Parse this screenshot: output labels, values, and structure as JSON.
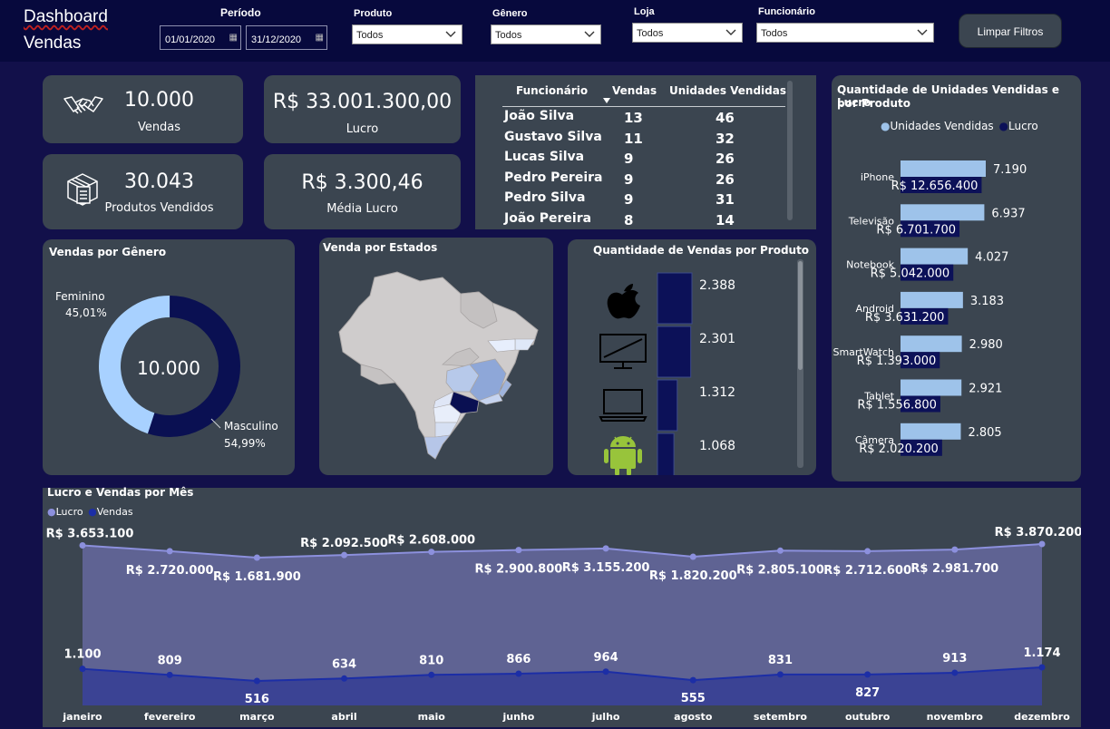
{
  "header": {
    "title_line1": "Dashboard",
    "title_line2": "Vendas",
    "periodo_label": "Período",
    "date_start": "01/01/2020",
    "date_end": "31/12/2020",
    "produto_label": "Produto",
    "produto_value": "Todos",
    "genero_label": "Gênero",
    "genero_value": "Todos",
    "loja_label": "Loja",
    "loja_value": "Todos",
    "funcionario_label": "Funcionário",
    "funcionario_value": "Todos",
    "clear_button": "Limpar Filtros"
  },
  "kpis": {
    "vendas_value": "10.000",
    "vendas_label": "Vendas",
    "lucro_value": "R$ 33.001.300,00",
    "lucro_label": "Lucro",
    "produtos_value": "30.043",
    "produtos_label": "Produtos Vendidos",
    "media_value": "R$ 3.300,46",
    "media_label": "Média Lucro"
  },
  "employees": {
    "headers": [
      "Funcionário",
      "Vendas",
      "Unidades Vendidas"
    ],
    "rows": [
      {
        "name": "João Silva",
        "vendas": "13",
        "unidades": "46"
      },
      {
        "name": "Gustavo Silva",
        "vendas": "11",
        "unidades": "32"
      },
      {
        "name": "Lucas Silva",
        "vendas": "9",
        "unidades": "26"
      },
      {
        "name": "Pedro Pereira",
        "vendas": "9",
        "unidades": "26"
      },
      {
        "name": "Pedro Silva",
        "vendas": "9",
        "unidades": "31"
      },
      {
        "name": "João Pereira",
        "vendas": "8",
        "unidades": "14"
      }
    ]
  },
  "genero": {
    "title": "Vendas por Gênero",
    "center": "10.000",
    "feminino_label": "Feminino",
    "feminino_pct": "45,01%",
    "masculino_label": "Masculino",
    "masculino_pct": "54,99%",
    "feminino_share": 0.4501,
    "masculino_share": 0.5499,
    "color_feminino": "#a8d1ff",
    "color_masculino": "#0a1052"
  },
  "estados": {
    "title": "Venda por Estados"
  },
  "produtos_vendas": {
    "title": "Quantidade de Vendas por Produto",
    "items": [
      {
        "icon": "apple-icon",
        "value": 2388,
        "label": "2.388"
      },
      {
        "icon": "television-icon",
        "value": 2301,
        "label": "2.301"
      },
      {
        "icon": "notebook-icon",
        "value": 1312,
        "label": "1.312"
      },
      {
        "icon": "android-icon",
        "value": 1068,
        "label": "1.068"
      }
    ]
  },
  "unidades_lucro": {
    "title_line1": "Quantidade de Unidades Vendidas e Lucro",
    "title_line2": "por Produto",
    "legend": [
      "Unidades Vendidas",
      "Lucro"
    ],
    "colors": {
      "unidades": "#9ec3ea",
      "lucro": "#0c1158"
    },
    "products": [
      {
        "name": "iPhone",
        "unidades": 7190,
        "unidades_label": "7.190",
        "lucro": 12656400,
        "lucro_label": "R$ 12.656.400"
      },
      {
        "name": "Televisão",
        "unidades": 6937,
        "unidades_label": "6.937",
        "lucro": 6701700,
        "lucro_label": "R$ 6.701.700"
      },
      {
        "name": "Notebook",
        "unidades": 4027,
        "unidades_label": "4.027",
        "lucro": 5042000,
        "lucro_label": "R$ 5.042.000"
      },
      {
        "name": "Android",
        "unidades": 3183,
        "unidades_label": "3.183",
        "lucro": 3631200,
        "lucro_label": "R$ 3.631.200"
      },
      {
        "name": "SmartWatch",
        "unidades": 2980,
        "unidades_label": "2.980",
        "lucro": 1393000,
        "lucro_label": "R$ 1.393.000"
      },
      {
        "name": "Tablet",
        "unidades": 2921,
        "unidades_label": "2.921",
        "lucro": 1556800,
        "lucro_label": "R$ 1.556.800"
      },
      {
        "name": "Câmera",
        "unidades": 2805,
        "unidades_label": "2.805",
        "lucro": 2020200,
        "lucro_label": "R$ 2.020.200"
      }
    ]
  },
  "chart_data": {
    "type": "area",
    "title": "Lucro e Vendas por Mês",
    "legend": [
      "Lucro",
      "Vendas"
    ],
    "categories": [
      "janeiro",
      "fevereiro",
      "março",
      "abril",
      "maio",
      "junho",
      "julho",
      "agosto",
      "setembro",
      "outubro",
      "novembro",
      "dezembro"
    ],
    "series": [
      {
        "name": "Lucro",
        "color": "#8c90dd",
        "values": [
          3653100,
          2720000,
          1681900,
          2092500,
          2608000,
          2900800,
          3155200,
          1820200,
          2805100,
          2712600,
          2981700,
          3870200
        ],
        "labels": [
          "R$ 3.653.100",
          "R$ 2.720.000",
          "R$ 1.681.900",
          "R$ 2.092.500",
          "R$ 2.608.000",
          "R$ 2.900.800",
          "R$ 3.155.200",
          "R$ 1.820.200",
          "R$ 2.805.100",
          "R$ 2.712.600",
          "R$ 2.981.700",
          "R$ 3.870.200"
        ]
      },
      {
        "name": "Vendas",
        "color": "#1c2ea6",
        "values": [
          1100,
          809,
          516,
          634,
          810,
          866,
          964,
          555,
          831,
          827,
          913,
          1174
        ],
        "labels": [
          "1.100",
          "809",
          "516",
          "634",
          "810",
          "866",
          "964",
          "555",
          "831",
          "827",
          "913",
          "1.174"
        ]
      }
    ]
  }
}
